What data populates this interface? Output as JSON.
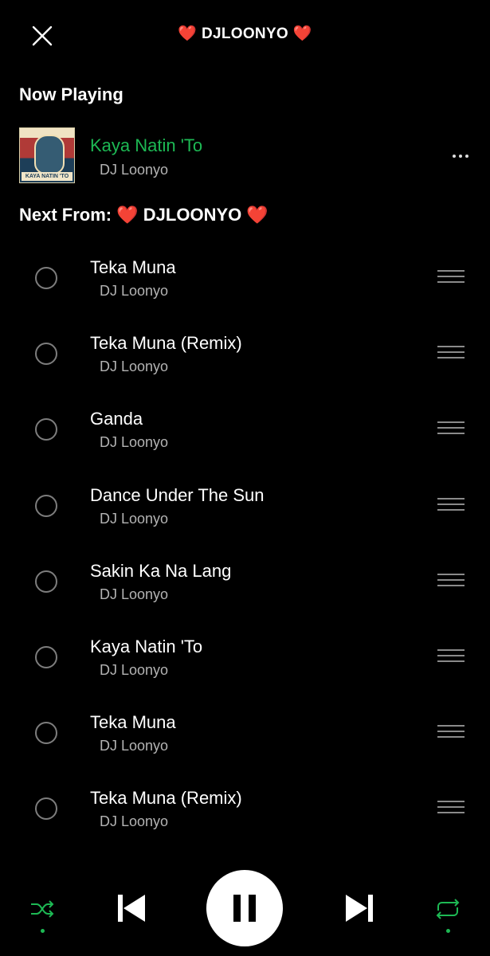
{
  "header": {
    "heart": "❤️",
    "title": "DJLOONYO"
  },
  "now_playing": {
    "section_label": "Now Playing",
    "title": "Kaya Natin 'To",
    "artist": "DJ Loonyo",
    "cover_caption": "KAYA NATIN 'TO"
  },
  "next_from": {
    "label": "Next From:",
    "playlist": "DJLOONYO"
  },
  "queue": [
    {
      "title": "Teka Muna",
      "artist": "DJ Loonyo"
    },
    {
      "title": "Teka Muna (Remix)",
      "artist": "DJ Loonyo"
    },
    {
      "title": "Ganda",
      "artist": "DJ Loonyo"
    },
    {
      "title": "Dance Under The Sun",
      "artist": "DJ Loonyo"
    },
    {
      "title": "Sakin Ka Na Lang",
      "artist": "DJ Loonyo"
    },
    {
      "title": "Kaya Natin 'To",
      "artist": "DJ Loonyo"
    },
    {
      "title": "Teka Muna",
      "artist": "DJ Loonyo"
    },
    {
      "title": "Teka Muna (Remix)",
      "artist": "DJ Loonyo"
    }
  ],
  "controls": {
    "shuffle_active": true,
    "repeat_active": true,
    "state": "playing"
  },
  "colors": {
    "accent": "#1db954",
    "background": "#000000",
    "secondary_text": "#b3b3b3",
    "heart": "#e02424"
  },
  "icons": {
    "close": "close-icon",
    "more": "more-options-icon",
    "drag": "drag-handle-icon",
    "shuffle": "shuffle-icon",
    "previous": "skip-previous-icon",
    "pause": "pause-icon",
    "next": "skip-next-icon",
    "repeat": "repeat-icon"
  }
}
